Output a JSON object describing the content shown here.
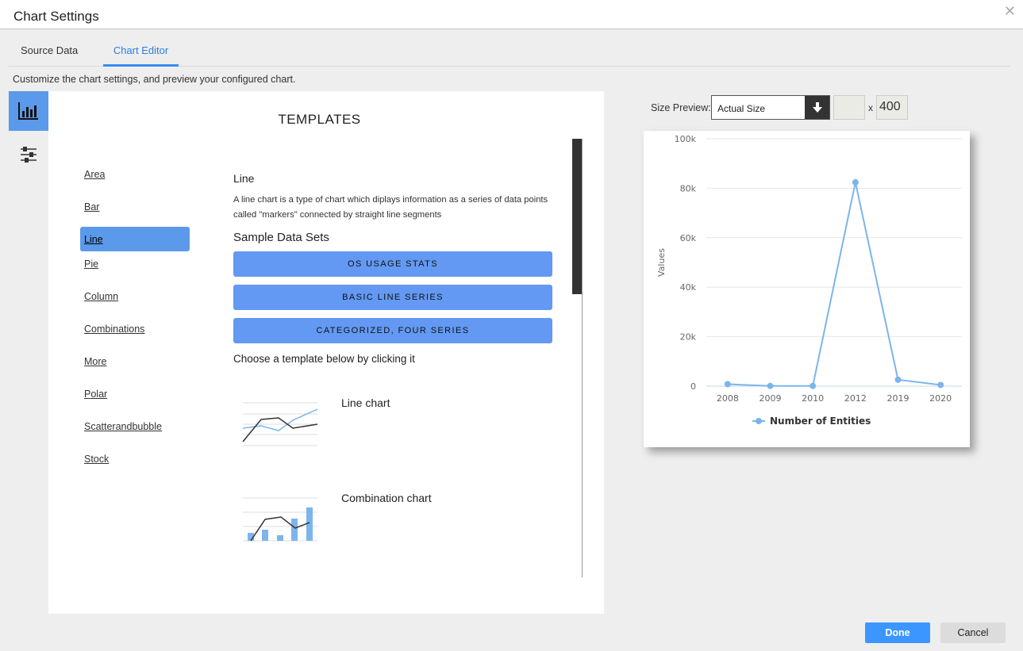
{
  "window": {
    "title": "Chart Settings",
    "close_icon": "close-icon"
  },
  "tabs": [
    {
      "label": "Source Data",
      "active": false
    },
    {
      "label": "Chart Editor",
      "active": true
    }
  ],
  "subtitle": "Customize the chart settings, and preview your configured chart.",
  "side_buttons": [
    {
      "icon": "bar-chart-icon",
      "active": true
    },
    {
      "icon": "sliders-icon",
      "active": false
    }
  ],
  "templates_panel": {
    "heading": "TEMPLATES",
    "categories": [
      "Area",
      "Bar",
      "Line",
      "Pie",
      "Column",
      "Combinations",
      "More",
      "Polar",
      "Scatterandbubble",
      "Stock"
    ],
    "selected_category": "Line",
    "detail": {
      "name": "Line",
      "description": "A line chart is a type of chart which diplays information as a series of data points called \"markers\" connected by straight line segments",
      "sample_sets_heading": "Sample Data Sets",
      "sample_sets": [
        "OS USAGE STATS",
        "BASIC LINE SERIES",
        "CATEGORIZED, FOUR SERIES"
      ],
      "choose_text": "Choose a template below by clicking it"
    },
    "template_cards": [
      {
        "label": "Line chart",
        "thumbnail": "line-chart-thumbnail"
      },
      {
        "label": "Combination chart",
        "thumbnail": "combination-chart-thumbnail"
      }
    ]
  },
  "size_preview": {
    "label": "Size Preview:",
    "selected": "Actual Size",
    "width_value": "",
    "x_label": "x",
    "height_value": "400"
  },
  "colors": {
    "accent": "#3c96ff",
    "selected_bg": "#5b9aea",
    "sample_btn": "#6399f2",
    "series": "#7cb5ec"
  },
  "chart_data": {
    "type": "line",
    "title": "",
    "xlabel": "",
    "ylabel": "Values",
    "categories": [
      "2008",
      "2009",
      "2010",
      "2012",
      "2019",
      "2020"
    ],
    "series": [
      {
        "name": "Number of Entities",
        "values": [
          800,
          100,
          100,
          82400,
          2600,
          500
        ]
      }
    ],
    "ylim": [
      0,
      100000
    ],
    "yticks": [
      0,
      20000,
      40000,
      60000,
      80000,
      100000
    ],
    "ytick_labels": [
      "0",
      "20k",
      "40k",
      "60k",
      "80k",
      "100k"
    ],
    "grid": true,
    "legend": "bottom-center"
  },
  "footer": {
    "done_label": "Done",
    "cancel_label": "Cancel"
  }
}
